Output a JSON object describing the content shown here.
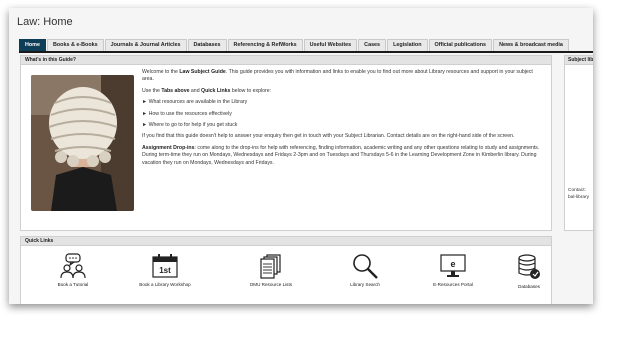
{
  "page": {
    "title": "Law: Home"
  },
  "tabs": [
    {
      "label": "Home",
      "active": true
    },
    {
      "label": "Books & e-Books"
    },
    {
      "label": "Journals & Journal Articles"
    },
    {
      "label": "Databases"
    },
    {
      "label": "Referencing & RefWorks"
    },
    {
      "label": "Useful Websites"
    },
    {
      "label": "Cases"
    },
    {
      "label": "Legislation"
    },
    {
      "label": "Official publications"
    },
    {
      "label": "News & broadcast media"
    }
  ],
  "guide": {
    "heading": "What's in this Guide?",
    "intro_prefix": "Welcome to the ",
    "intro_bold": "Law Subject Guide",
    "intro_suffix": ". This guide provides you with information and links to enable you to find out more about Library resources and support in your subject area.",
    "use_prefix": "Use the ",
    "use_bold1": "Tabs above",
    "use_mid": " and ",
    "use_bold2": "Quick Links",
    "use_suffix": " below to explore:",
    "bullets": [
      "► What resources are available in the Library",
      "► How to use the resources effectively",
      "► Where to go to for help if you get stuck"
    ],
    "help_text": "If you find that this guide doesn't help to answer your enquiry then get in touch with your Subject Librarian. Contact details are on the right-hand side of the screen.",
    "dropins_bold": "Assignment Drop-ins",
    "dropins_text": ": come along to the drop-ins for help with referencing, finding information, academic writing and any other questions relating to study and assignments. During term-time they run on Mondays, Wednesdays and Fridays 2-3pm and on Tuesdays and Thursdays 5-6 in the Learning Development Zone in Kimberlin library. During vacation they run on Mondays, Wednesdays and Fridays."
  },
  "quick_links": {
    "heading": "Quick Links",
    "items": [
      {
        "label": "Book a Tutorial",
        "icon": "people-chat-icon"
      },
      {
        "label": "Book a Library Workshop",
        "icon": "calendar-icon",
        "badge": "1st"
      },
      {
        "label": "DMU Resource Lists",
        "icon": "document-icon"
      },
      {
        "label": "Library Search",
        "icon": "search-icon"
      },
      {
        "label": "E-Resources Portal",
        "icon": "monitor-icon",
        "badge": "e"
      },
      {
        "label": "Databases",
        "icon": "database-icon"
      }
    ]
  },
  "sidebar": {
    "heading": "Subject lib",
    "contact_label": "Contact:",
    "contact_email": "bal-library"
  },
  "colors": {
    "active_tab": "#0d3d57",
    "panel_head": "#e3e3e3"
  }
}
